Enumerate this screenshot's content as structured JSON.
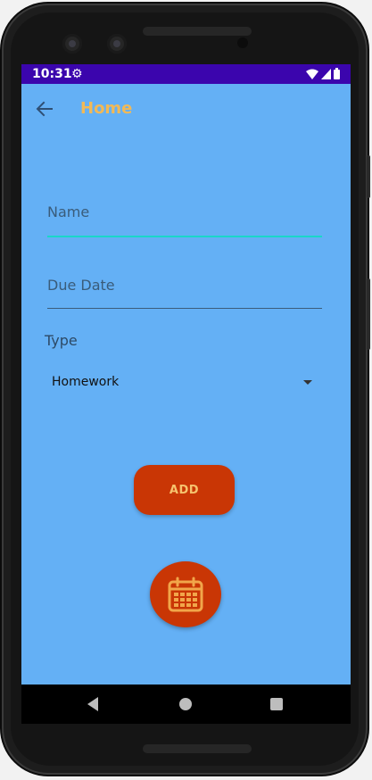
{
  "status_bar": {
    "time": "10:31",
    "icons": [
      "gear-icon",
      "wifi-icon",
      "signal-icon",
      "battery-icon"
    ]
  },
  "toolbar": {
    "title": "Home",
    "back_icon": "arrow-left-icon"
  },
  "form": {
    "name": {
      "placeholder": "Name",
      "value": ""
    },
    "due_date": {
      "placeholder": "Due Date",
      "value": ""
    },
    "type_label": "Type",
    "type_selected": "Homework"
  },
  "add_button": {
    "label": "ADD"
  },
  "fab": {
    "icon": "calendar-icon"
  },
  "nav_bar": {
    "icons": [
      "back-triangle-icon",
      "home-circle-icon",
      "recents-square-icon"
    ]
  },
  "colors": {
    "screen_bg": "#64b0f5",
    "status_bar": "#3b05ad",
    "title": "#f1b957",
    "accent_button": "#c93605",
    "button_text": "#f6c36e",
    "focus_underline": "#1ad7c8"
  }
}
